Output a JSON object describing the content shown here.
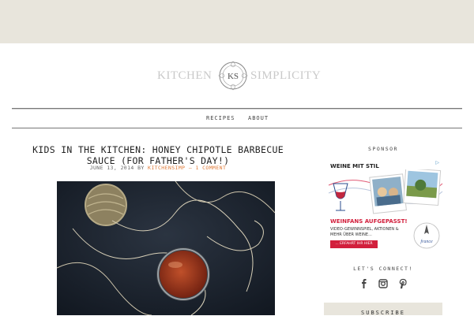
{
  "site": {
    "logo_left": "KITCHEN",
    "logo_monogram": "KS",
    "logo_right": "SIMPLICITY"
  },
  "nav": {
    "items": [
      {
        "label": "RECIPES"
      },
      {
        "label": "ABOUT"
      }
    ]
  },
  "post": {
    "title": "KIDS IN THE KITCHEN: HONEY CHIPOTLE BARBECUE SAUCE (FOR FATHER'S DAY!)",
    "date": "JUNE 13, 2014",
    "by": "BY",
    "author": "KITCHENSIMP",
    "separator": "–",
    "comments": "1 COMMENT"
  },
  "sidebar": {
    "sponsor_heading": "SPONSOR",
    "ad": {
      "headline": "WEINE MIT STIL",
      "badge": "▷",
      "fans": "WEINFANS AUFGEPASST!",
      "body": "VIDEO-GEWINNSPIEL, AKTIONEN & MEHR ÜBER WEINE...",
      "cta": "... ERFAHRT IHR HIER",
      "stamp": "france"
    },
    "connect_heading": "LET'S CONNECT!",
    "social": [
      {
        "icon": "facebook-icon",
        "glyph": "f"
      },
      {
        "icon": "instagram-icon",
        "glyph": "◘"
      },
      {
        "icon": "pinterest-icon",
        "glyph": "P"
      }
    ],
    "subscribe_label": "SUBSCRIBE"
  },
  "colors": {
    "topbar": "#e8e5dc",
    "accent": "#e07b39",
    "ad_red": "#d21f3c"
  }
}
